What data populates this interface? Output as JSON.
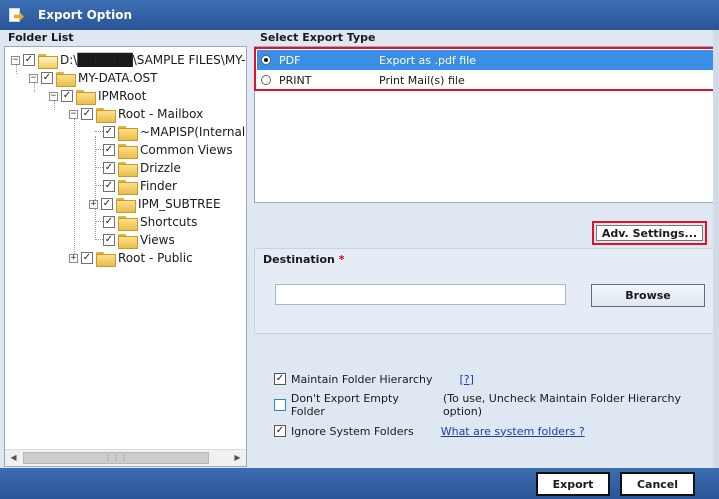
{
  "window": {
    "title": "Export Option"
  },
  "folder_list": {
    "header": "Folder List",
    "items": [
      {
        "label": "D:\\██████\\SAMPLE FILES\\MY-DA",
        "checked": true,
        "expander": "-"
      },
      {
        "label": "MY-DATA.OST",
        "checked": true,
        "expander": "-"
      },
      {
        "label": "IPMRoot",
        "checked": true,
        "expander": "-"
      },
      {
        "label": "Root - Mailbox",
        "checked": true,
        "expander": "-"
      },
      {
        "label": "~MAPISP(Internal)",
        "checked": true,
        "expander": ""
      },
      {
        "label": "Common Views",
        "checked": true,
        "expander": ""
      },
      {
        "label": "Drizzle",
        "checked": true,
        "expander": ""
      },
      {
        "label": "Finder",
        "checked": true,
        "expander": ""
      },
      {
        "label": "IPM_SUBTREE",
        "checked": true,
        "expander": "+"
      },
      {
        "label": "Shortcuts",
        "checked": true,
        "expander": ""
      },
      {
        "label": "Views",
        "checked": true,
        "expander": ""
      },
      {
        "label": "Root - Public",
        "checked": true,
        "expander": "+"
      }
    ]
  },
  "export_type": {
    "header": "Select Export Type",
    "options": [
      {
        "name": "PDF",
        "desc": "Export as .pdf file",
        "selected": true
      },
      {
        "name": "PRINT",
        "desc": "Print Mail(s) file",
        "selected": false
      }
    ]
  },
  "adv_settings_label": "Adv. Settings...",
  "destination": {
    "label": "Destination",
    "required_mark": "*",
    "value": "",
    "browse_label": "Browse"
  },
  "options": {
    "maintain_hierarchy": {
      "label": "Maintain Folder Hierarchy",
      "checked": true,
      "help": "[?]"
    },
    "dont_export_empty": {
      "label": "Don't Export Empty Folder",
      "checked": false,
      "hint": "(To use, Uncheck Maintain Folder Hierarchy option)"
    },
    "ignore_system": {
      "label": "Ignore System Folders",
      "checked": true,
      "link": "What are system folders ?"
    }
  },
  "footer": {
    "export_label": "Export",
    "cancel_label": "Cancel"
  },
  "colors": {
    "title_bar": "#2a5597",
    "selection": "#3a8ee6",
    "highlight_border": "#e0122a"
  }
}
